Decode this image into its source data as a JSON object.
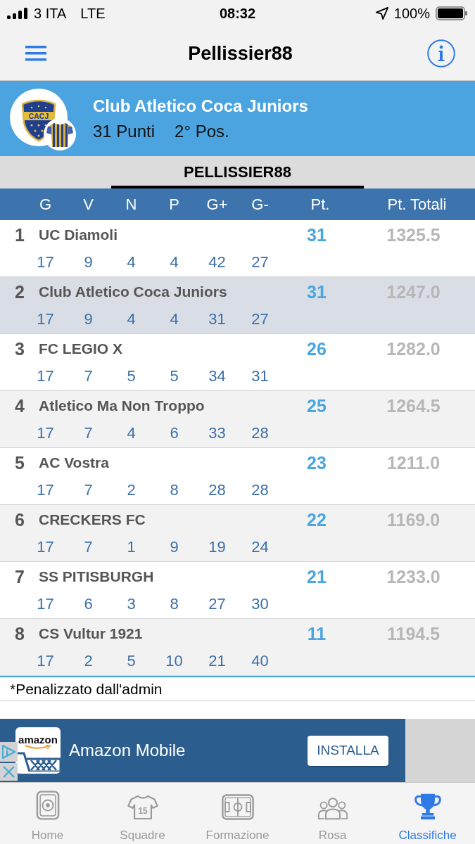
{
  "status_bar": {
    "carrier": "3 ITA",
    "network": "LTE",
    "time": "08:32",
    "battery": "100%"
  },
  "nav_bar": {
    "title": "Pellissier88"
  },
  "team_header": {
    "crest_text": "CACJ",
    "name": "Club Atletico Coca Juniors",
    "points": "31 Punti",
    "position": "2° Pos."
  },
  "segments": [
    {
      "label": "PELLISSIER88",
      "selected": true
    }
  ],
  "table": {
    "columns": [
      "G",
      "V",
      "N",
      "P",
      "G+",
      "G-",
      "Pt.",
      "Pt. Totali"
    ],
    "rows": [
      {
        "rank": "1",
        "team": "UC Diamoli",
        "stats": [
          "17",
          "9",
          "4",
          "4",
          "42",
          "27"
        ],
        "points": "31",
        "total": "1325.5",
        "selected": false
      },
      {
        "rank": "2",
        "team": "Club Atletico Coca Juniors",
        "stats": [
          "17",
          "9",
          "4",
          "4",
          "31",
          "27"
        ],
        "points": "31",
        "total": "1247.0",
        "selected": true
      },
      {
        "rank": "3",
        "team": "FC LEGIO X",
        "stats": [
          "17",
          "7",
          "5",
          "5",
          "34",
          "31"
        ],
        "points": "26",
        "total": "1282.0",
        "selected": false
      },
      {
        "rank": "4",
        "team": "Atletico Ma Non Troppo",
        "stats": [
          "17",
          "7",
          "4",
          "6",
          "33",
          "28"
        ],
        "points": "25",
        "total": "1264.5",
        "selected": false
      },
      {
        "rank": "5",
        "team": "AC Vostra",
        "stats": [
          "17",
          "7",
          "2",
          "8",
          "28",
          "28"
        ],
        "points": "23",
        "total": "1211.0",
        "selected": false
      },
      {
        "rank": "6",
        "team": "CRECKERS FC",
        "stats": [
          "17",
          "7",
          "1",
          "9",
          "19",
          "24"
        ],
        "points": "22",
        "total": "1169.0",
        "selected": false
      },
      {
        "rank": "7",
        "team": "SS PITISBURGH",
        "stats": [
          "17",
          "6",
          "3",
          "8",
          "27",
          "30"
        ],
        "points": "21",
        "total": "1233.0",
        "selected": false
      },
      {
        "rank": "8",
        "team": "CS Vultur 1921",
        "stats": [
          "17",
          "2",
          "5",
          "10",
          "21",
          "40"
        ],
        "points": "11",
        "total": "1194.5",
        "selected": false
      }
    ]
  },
  "footnote": "*Penalizzato dall'admin",
  "ad": {
    "logo_text": "amazon",
    "title": "Amazon Mobile",
    "button": "INSTALLA"
  },
  "tab_bar": [
    {
      "label": "Home",
      "kind": "home",
      "selected": false
    },
    {
      "label": "Squadre",
      "kind": "jersey",
      "icon_text": "15",
      "selected": false
    },
    {
      "label": "Formazione",
      "kind": "field",
      "selected": false
    },
    {
      "label": "Rosa",
      "kind": "people",
      "selected": false
    },
    {
      "label": "Classifiche",
      "kind": "trophy",
      "selected": true
    }
  ]
}
